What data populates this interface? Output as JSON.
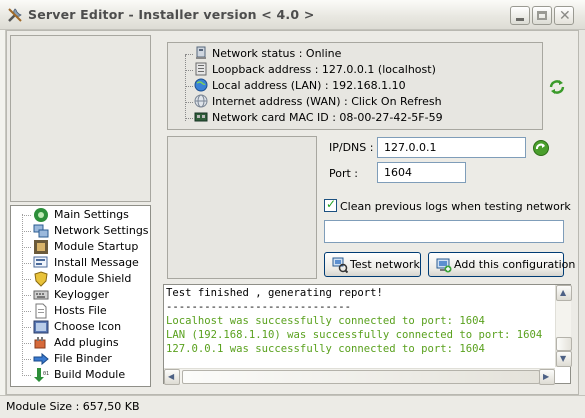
{
  "window": {
    "title": "Server Editor - Installer version < 4.0 >"
  },
  "tree": {
    "items": [
      {
        "label": "Main Settings",
        "icon": "main-settings-icon"
      },
      {
        "label": "Network Settings",
        "icon": "network-settings-icon"
      },
      {
        "label": "Module Startup",
        "icon": "module-startup-icon"
      },
      {
        "label": "Install Message",
        "icon": "install-message-icon"
      },
      {
        "label": "Module Shield",
        "icon": "shield-icon"
      },
      {
        "label": "Keylogger",
        "icon": "keyboard-icon"
      },
      {
        "label": "Hosts File",
        "icon": "hosts-file-icon"
      },
      {
        "label": "Choose Icon",
        "icon": "choose-icon-icon"
      },
      {
        "label": "Add plugins",
        "icon": "plugin-icon"
      },
      {
        "label": "File Binder",
        "icon": "file-binder-icon"
      },
      {
        "label": "Build Module",
        "icon": "build-module-icon"
      }
    ]
  },
  "network_status": {
    "rows": [
      {
        "text": "Network status : Online",
        "icon": "network-status-icon"
      },
      {
        "text": "Loopback address : 127.0.0.1 (localhost)",
        "icon": "loopback-icon"
      },
      {
        "text": "Local address (LAN) : 192.168.1.10",
        "icon": "globe-icon"
      },
      {
        "text": "Internet address (WAN) : Click On Refresh",
        "icon": "internet-icon"
      },
      {
        "text": "Network card MAC ID : 08-00-27-42-5F-59",
        "icon": "network-card-icon"
      }
    ]
  },
  "form": {
    "ip_label": "IP/DNS :",
    "ip_value": "127.0.0.1",
    "port_label": "Port :",
    "port_value": "1604",
    "clean_logs_label": "Clean previous logs when testing network",
    "clean_logs_checked": true,
    "extra_value": ""
  },
  "buttons": {
    "test_network": "Test network",
    "add_configuration": "Add this configuration"
  },
  "console": {
    "lines": [
      {
        "text": "Test finished , generating report!",
        "color": "#000000"
      },
      {
        "text": "-----------------------------",
        "color": "#000000"
      },
      {
        "text": "Localhost was successfully connected to port: 1604",
        "color": "#5aa11e"
      },
      {
        "text": "LAN (192.168.1.10) was successfully connected to port: 1604",
        "color": "#5aa11e"
      },
      {
        "text": "127.0.0.1 was successfully connected to port: 1604",
        "color": "#5aa11e"
      }
    ]
  },
  "statusbar": {
    "text": "Module Size : 657,50 KB"
  }
}
